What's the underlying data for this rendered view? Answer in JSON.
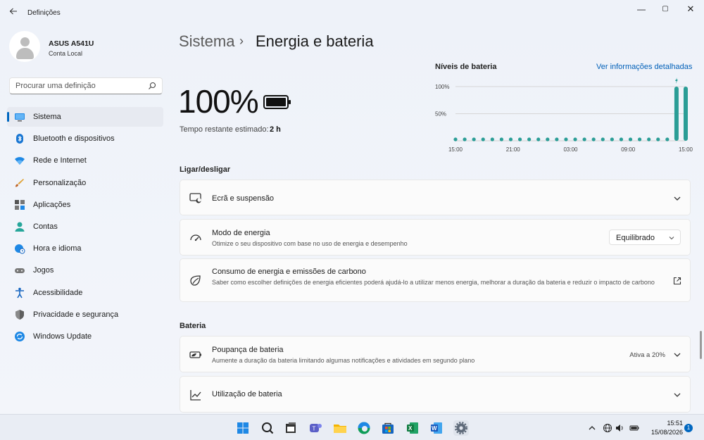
{
  "app": {
    "title": "Definições"
  },
  "window_controls": {
    "minimize": "—",
    "maximize": "▢",
    "close": "✕"
  },
  "user": {
    "name": "ASUS A541U",
    "account": "Conta Local"
  },
  "search": {
    "placeholder": "Procurar uma definição"
  },
  "sidebar": {
    "items": [
      {
        "label": "Sistema",
        "icon": "monitor-icon",
        "active": true
      },
      {
        "label": "Bluetooth e dispositivos",
        "icon": "bluetooth-icon"
      },
      {
        "label": "Rede e Internet",
        "icon": "wifi-icon"
      },
      {
        "label": "Personalização",
        "icon": "brush-icon"
      },
      {
        "label": "Aplicações",
        "icon": "apps-icon"
      },
      {
        "label": "Contas",
        "icon": "person-icon"
      },
      {
        "label": "Hora e idioma",
        "icon": "globe-clock-icon"
      },
      {
        "label": "Jogos",
        "icon": "gamepad-icon"
      },
      {
        "label": "Acessibilidade",
        "icon": "accessibility-icon"
      },
      {
        "label": "Privacidade e segurança",
        "icon": "shield-icon"
      },
      {
        "label": "Windows Update",
        "icon": "update-icon"
      }
    ]
  },
  "breadcrumb": {
    "parent": "Sistema",
    "separator": "›",
    "current": "Energia e bateria"
  },
  "battery": {
    "percent": "100%",
    "estimate_label": "Tempo restante estimado:",
    "estimate_value": "2 h"
  },
  "chart_header": {
    "title": "Níveis de bateria",
    "link": "Ver informações detalhadas"
  },
  "chart_data": {
    "type": "bar",
    "title": "Níveis de bateria",
    "y_ticks": [
      "100%",
      "50%"
    ],
    "ylim": [
      0,
      100
    ],
    "x_ticks": [
      "15:00",
      "21:00",
      "03:00",
      "09:00",
      "15:00"
    ],
    "values": [
      0,
      0,
      0,
      0,
      0,
      0,
      0,
      0,
      0,
      0,
      0,
      0,
      0,
      0,
      0,
      0,
      0,
      0,
      0,
      0,
      0,
      0,
      0,
      0,
      100,
      100
    ],
    "charging_marker_index": 24,
    "color": "#2a9d96"
  },
  "sections": {
    "power": "Ligar/desligar",
    "battery": "Bateria"
  },
  "cards": {
    "screen_sleep": {
      "title": "Ecrã e suspensão"
    },
    "power_mode": {
      "title": "Modo de energia",
      "desc": "Otimize o seu dispositivo com base no uso de energia e desempenho",
      "value": "Equilibrado"
    },
    "carbon": {
      "title": "Consumo de energia e emissões de carbono",
      "desc": "Saber como escolher definições de energia eficientes poderá ajudá-lo a utilizar menos energia, melhorar a duração da bateria e reduzir o impacto de carbono"
    },
    "saver": {
      "title": "Poupança de bateria",
      "desc": "Aumente a duração da bateria limitando algumas notificações e atividades em segundo plano",
      "status": "Ativa a 20%"
    },
    "usage": {
      "title": "Utilização de bateria"
    }
  },
  "taskbar": {
    "apps": [
      "start-icon",
      "search-icon",
      "file-explorer-icon",
      "teams-icon",
      "folder-icon",
      "edge-icon",
      "store-icon",
      "excel-icon",
      "word-icon",
      "settings-icon"
    ],
    "time": "15:51",
    "date": "15/08/2026",
    "notifications": "1"
  },
  "colors": {
    "accent": "#0067c0",
    "chart": "#2a9d96"
  }
}
